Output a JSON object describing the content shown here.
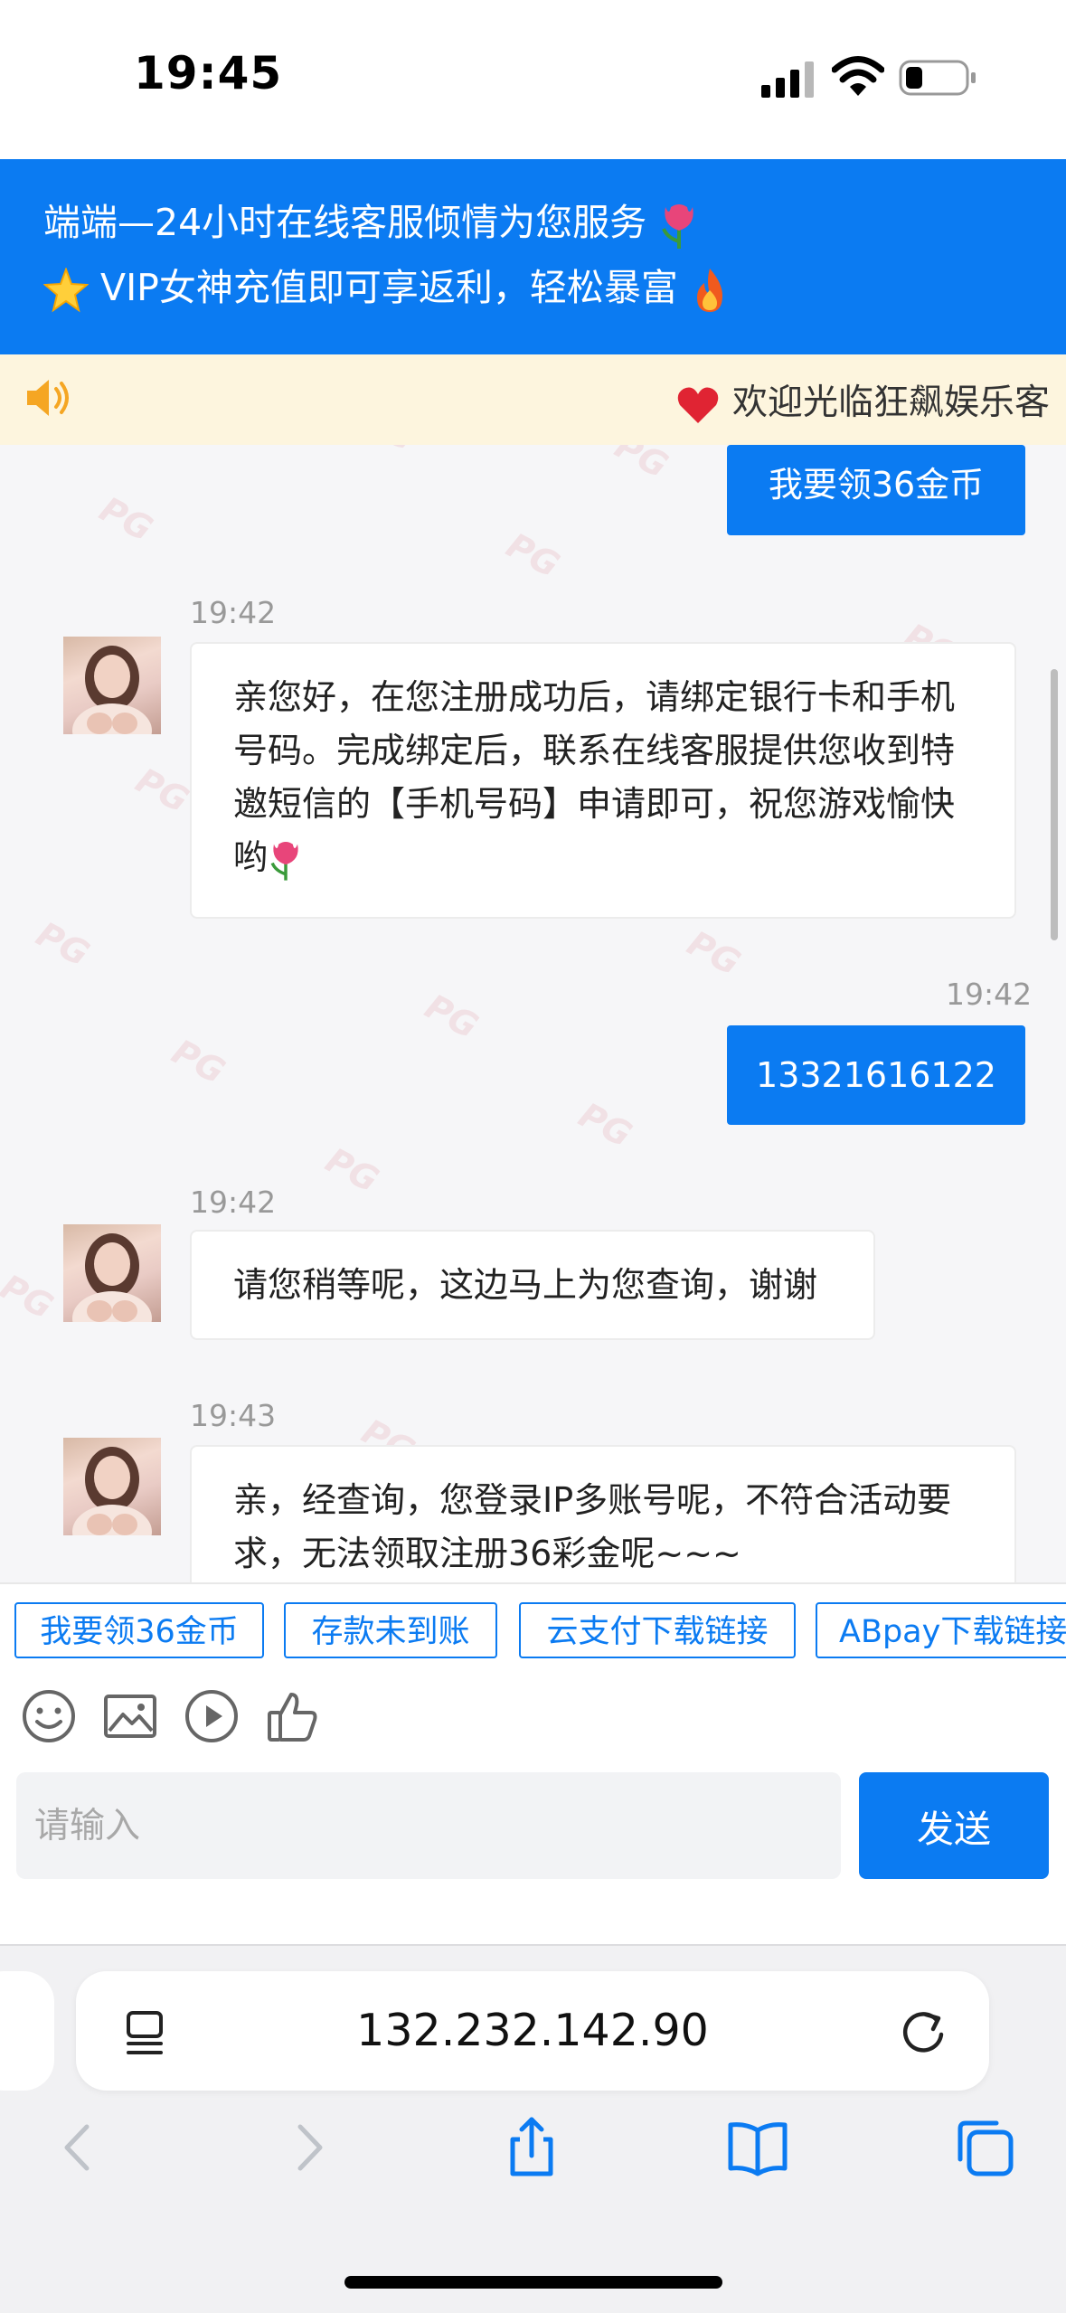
{
  "status_bar": {
    "time": "19:45"
  },
  "header": {
    "line1": "端端—24小时在线客服倾情为您服务",
    "line2": "VIP女神充值即可享返利，轻松暴富"
  },
  "notice": {
    "text": "欢迎光临狂飙娱乐客"
  },
  "watermark": {
    "text": "PG"
  },
  "messages": [
    {
      "from": "user",
      "text": "我要领36金币"
    },
    {
      "from": "agent",
      "time": "19:42",
      "text": "亲您好，在您注册成功后，请绑定银行卡和手机号码。完成绑定后，联系在线客服提供您收到特邀短信的【手机号码】申请即可，祝您游戏愉快哟"
    },
    {
      "from": "user",
      "time": "19:42",
      "text": "13321616122"
    },
    {
      "from": "agent",
      "time": "19:42",
      "text": "请您稍等呢，这边马上为您查询，谢谢"
    },
    {
      "from": "agent",
      "time": "19:43",
      "text": "亲，经查询，您登录IP多账号呢，不符合活动要求，无法领取注册36彩金呢~~~"
    }
  ],
  "quick_replies": [
    "我要领36金币",
    "存款未到账",
    "云支付下载链接",
    "ABpay下载链接"
  ],
  "toolbar_icons": [
    "smiley-icon",
    "image-icon",
    "video-icon",
    "thumbs-up-icon"
  ],
  "input": {
    "placeholder": "请输入",
    "value": ""
  },
  "send_label": "发送",
  "browser": {
    "url": "132.232.142.90"
  },
  "colors": {
    "accent": "#0b7bf2",
    "notice_bg": "#fdf5de",
    "chat_bg": "#f6f6f8"
  }
}
